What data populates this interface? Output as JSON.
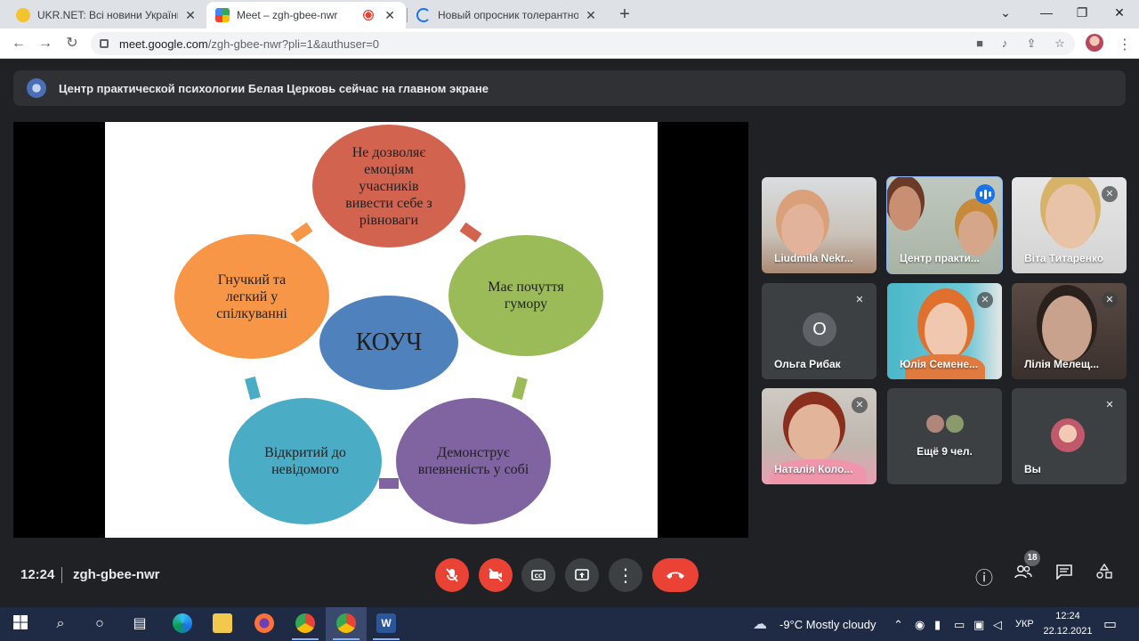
{
  "browser": {
    "tabs": [
      {
        "title": "UKR.NET: Всі новини України, ос",
        "close": "✕",
        "active": false
      },
      {
        "title": "Meet – zgh-gbee-nwr",
        "close": "✕",
        "active": true
      },
      {
        "title": "Новый опросник толерантност",
        "close": "✕",
        "active": false
      }
    ],
    "new_tab": "+",
    "window_controls": {
      "minimize": "—",
      "restore": "❐",
      "close": "✕",
      "tab_search": "⌄"
    },
    "url_host": "meet.google.com",
    "url_path": "/zgh-gbee-nwr?pli=1&authuser=0"
  },
  "meet": {
    "banner_text": "Центр практической психологии Белая Церковь сейчас на главном экране",
    "slide": {
      "center": "КОУЧ",
      "top": "Не дозволяє емоціям учасників вивести себе з рівноваги",
      "right": "Має почуття гумору",
      "bottom_right": "Демонструє впевненість у собі",
      "bottom_left": "Відкритий до невідомого",
      "left": "Гнучкий та легкий у спілкуванні"
    },
    "participants": [
      {
        "name": "Liudmila Nekr..."
      },
      {
        "name": "Центр практи..."
      },
      {
        "name": "Віта Титаренко"
      },
      {
        "name": "Ольга Рибак",
        "initial": "О"
      },
      {
        "name": "Юлія Семене..."
      },
      {
        "name": "Лілія Мелещ..."
      },
      {
        "name": "Наталія Коло..."
      },
      {
        "name": "Ещё 9 чел."
      },
      {
        "name": "Вы"
      }
    ],
    "time": "12:24",
    "meeting_code": "zgh-gbee-nwr",
    "people_count": "18"
  },
  "taskbar": {
    "weather": "-9°C  Mostly cloudy",
    "lang": "УКР",
    "time": "12:24",
    "date": "22.12.2021"
  },
  "colors": {
    "top_circle": "#d2634f",
    "right_circle": "#9bbb59",
    "bottom_right_circle": "#8064a2",
    "bottom_left_circle": "#4bacc6",
    "left_circle": "#f79646",
    "center_circle": "#4f81bd",
    "hangup": "#ea4335"
  }
}
